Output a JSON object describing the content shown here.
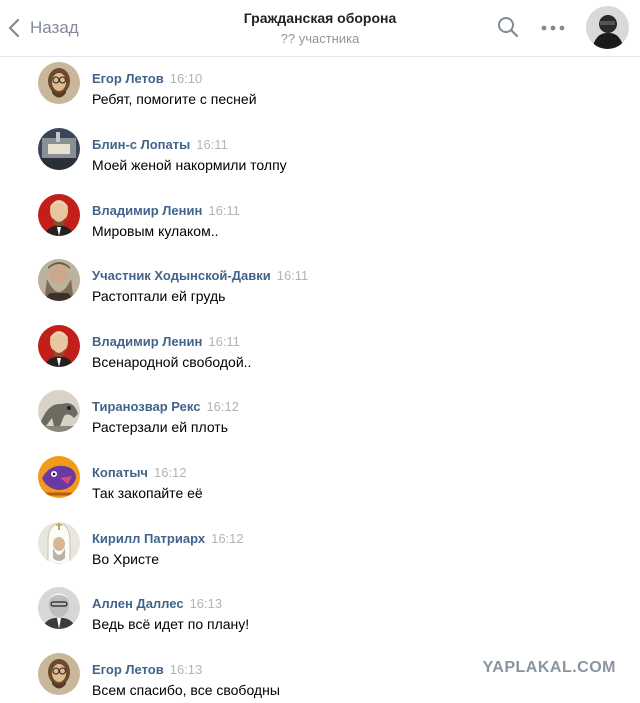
{
  "header": {
    "back_label": "Назад",
    "title": "Гражданская оборона",
    "subtitle": "?? участника",
    "search_icon": "search-icon",
    "more_icon": "more-icon"
  },
  "messages": [
    {
      "name": "Егор Летов",
      "time": "16:10",
      "text": "Ребят, помогите с песней"
    },
    {
      "name": "Блин-с Лопаты",
      "time": "16:11",
      "text": "Моей женой накормили толпу"
    },
    {
      "name": "Владимир Ленин",
      "time": "16:11",
      "text": "Мировым кулаком.."
    },
    {
      "name": "Участник Ходынской-Давки",
      "time": "16:11",
      "text": "Растоптали ей грудь"
    },
    {
      "name": "Владимир Ленин",
      "time": "16:11",
      "text": "Всенародной свободой.."
    },
    {
      "name": "Тиранозвар Рекс",
      "time": "16:12",
      "text": "Растерзали ей плоть"
    },
    {
      "name": "Копатыч",
      "time": "16:12",
      "text": "Так закопайте её"
    },
    {
      "name": "Кирилл Патриарх",
      "time": "16:12",
      "text": "Во Христе"
    },
    {
      "name": "Аллен Даллес",
      "time": "16:13",
      "text": "Ведь всё идет по плану!"
    },
    {
      "name": "Егор Летов",
      "time": "16:13",
      "text": "Всем спасибо, все свободны"
    }
  ],
  "watermark": "YAPLAKAL.COM",
  "colors": {
    "name": "#42648b",
    "time": "#b0b4b8",
    "header_icon": "#828a99"
  }
}
